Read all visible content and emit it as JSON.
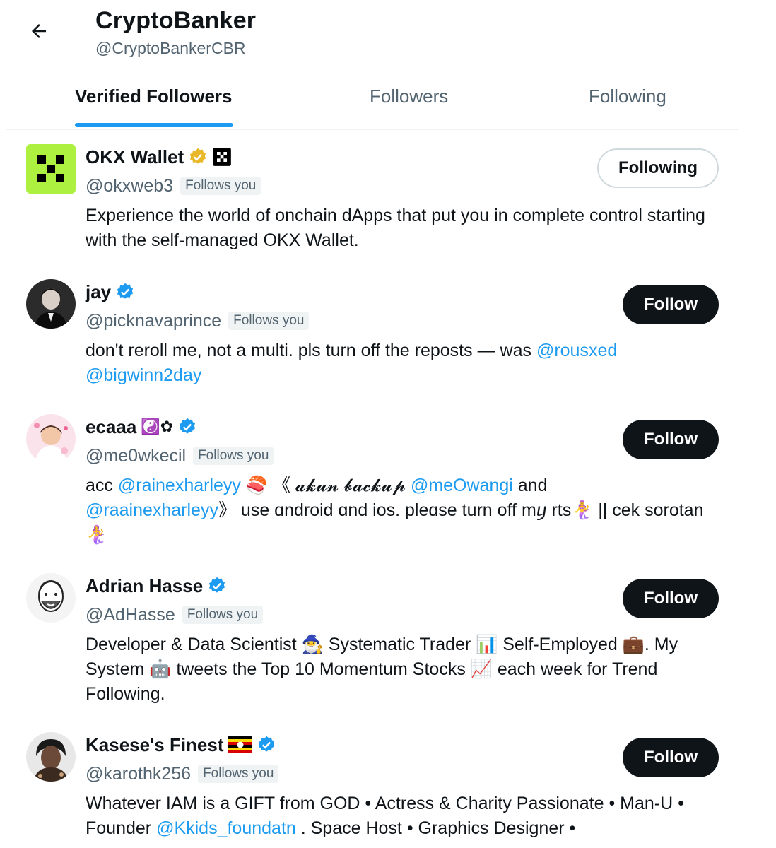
{
  "header": {
    "back_label": "←",
    "name": "CryptoBanker",
    "handle": "@CryptoBankerCBR"
  },
  "tabs": [
    {
      "label": "Verified Followers",
      "active": true
    },
    {
      "label": "Followers",
      "active": false
    },
    {
      "label": "Following",
      "active": false
    }
  ],
  "colors": {
    "accent": "#1d9bf0",
    "verified_gold": "#e8b829",
    "okx_green": "#adf040"
  },
  "users": [
    {
      "name": "OKX Wallet",
      "handle": "@okxweb3",
      "follows_you": "Follows you",
      "button": "Following",
      "badge": "gold-verified-badge",
      "bio": "Experience the world of onchain dApps that put you in complete control starting with the self-managed OKX Wallet."
    },
    {
      "name": "jay",
      "handle": "@picknavaprince",
      "follows_you": "Follows you",
      "button": "Follow",
      "badge": "blue-verified-badge",
      "bio_text": "don't reroll me, not a multi. pls turn off the reposts — was ",
      "bio_mention_1": "@rousxed",
      "bio_mention_2": "@bigwinn2day"
    },
    {
      "name": "ecaaa",
      "name_emoji": "☯️✿",
      "handle": "@me0wkecil",
      "follows_you": "Follows you",
      "button": "Follow",
      "badge": "blue-verified-badge",
      "bio_1": "acc ",
      "bio_mention_1": "@rainexharleyy",
      "bio_2": " 🍣 《 𝓪𝓴𝓾𝓷 𝓫𝓪𝓬𝓴𝓾𝓹 ",
      "bio_mention_2": "@meOwangi",
      "bio_3": " and ",
      "bio_mention_3": "@raainexharleyy",
      "bio_4": "》 use ɑndroid ɑnd ios. pleɑse turn off mⴘ rts🧜‍♀️ || cek sorotan🧜‍♀️"
    },
    {
      "name": "Adrian Hasse",
      "handle": "@AdHasse",
      "follows_you": "Follows you",
      "button": "Follow",
      "badge": "blue-verified-badge",
      "bio": "Developer & Data Scientist 🧙‍♂️ Systematic Trader 📊 Self-Employed 💼. My System 🤖 tweets the Top 10 Momentum Stocks 📈 each week for Trend Following."
    },
    {
      "name": "Kasese's Finest",
      "name_emoji": "🇺🇬",
      "handle": "@karothk256",
      "follows_you": "Follows you",
      "button": "Follow",
      "badge": "blue-verified-badge",
      "bio_1": "Whatever IAM is a GIFT from GOD • Actress & Charity Passionate • Man-U • Founder ",
      "bio_mention_1": "@Kkids_foundatn",
      "bio_2": " . Space Host • Graphics Designer •"
    }
  ]
}
